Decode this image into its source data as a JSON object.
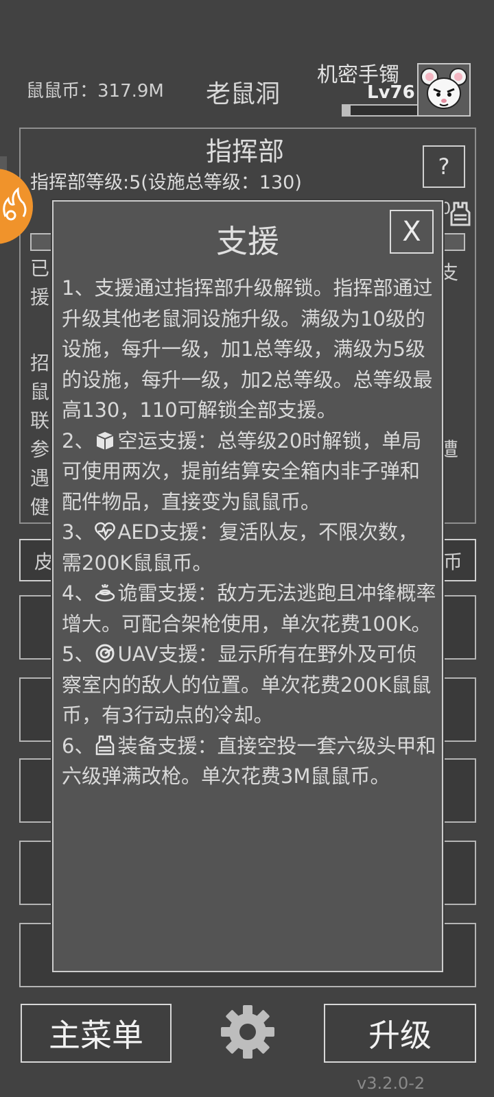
{
  "header": {
    "coins": "鼠鼠币：317.9M",
    "title": "老鼠洞",
    "item_name": "机密手镯",
    "level": "Lv76",
    "xp_progress": 0.1
  },
  "panel": {
    "title": "指挥部",
    "level_text": "指挥部等级:5(设施总等级：130)",
    "help_label": "?",
    "left_chars": [
      "已",
      "援",
      "招",
      "鼠",
      "联",
      "参",
      "遇",
      "健"
    ],
    "right_chars": [
      "支",
      "遭"
    ],
    "left_tab_char": "皮",
    "right_tab_char": "币",
    "partial_number": "0"
  },
  "dialog": {
    "title": "支援",
    "close_label": "X",
    "intro": "1、支援通过指挥部升级解锁。指挥部通过升级其他老鼠洞设施升级。满级为10级的设施，每升一级，加1总等级，满级为5级的设施，每升一级，加2总等级。总等级最高130，110可解锁全部支援。",
    "items": [
      {
        "prefix": "2、",
        "icon": "crate-icon",
        "text": "空运支援：总等级20时解锁，单局可使用两次，提前结算安全箱内非子弹和配件物品，直接变为鼠鼠币。"
      },
      {
        "prefix": "3、",
        "icon": "heartbeat-icon",
        "text": "AED支援：复活队友，不限次数，需200K鼠鼠币。"
      },
      {
        "prefix": "4、",
        "icon": "mine-icon",
        "text": "诡雷支援：敌方无法逃跑且冲锋概率增大。可配合架枪使用，单次花费100K。"
      },
      {
        "prefix": "5、",
        "icon": "radar-icon",
        "text": "UAV支援：显示所有在野外及可侦察室内的敌人的位置。单次花费200K鼠鼠币，有3行动点的冷却。"
      },
      {
        "prefix": "6、",
        "icon": "vest-icon",
        "text": "装备支援：直接空投一套六级头甲和六级弹满改枪。单次花费3M鼠鼠币。"
      }
    ]
  },
  "bottom": {
    "menu_label": "主菜单",
    "upgrade_label": "升级",
    "version": "v3.2.0-2"
  },
  "colors": {
    "background": "#424242",
    "dialog": "#545454",
    "accent_orange": "#f0932b"
  }
}
